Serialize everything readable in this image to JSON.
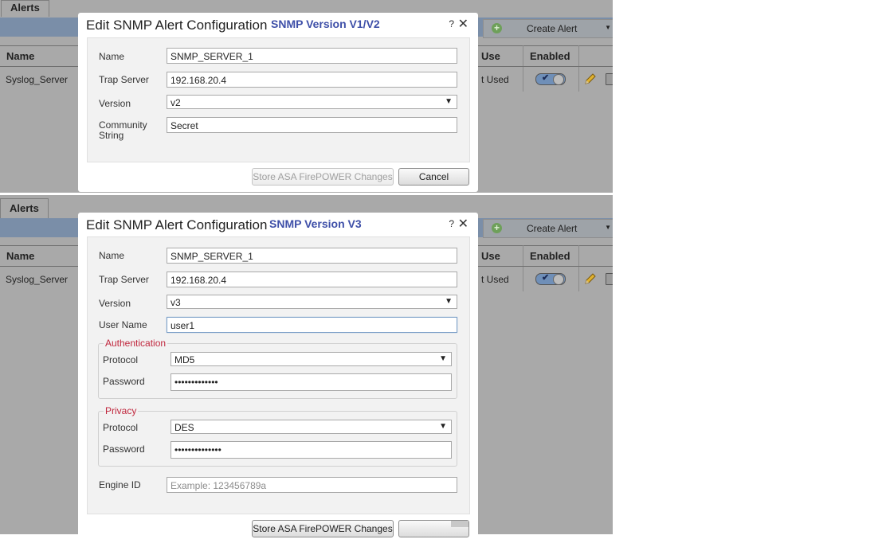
{
  "background": {
    "tab_label": "Alerts",
    "create_alert_label": "Create Alert",
    "columns": {
      "name": "Name",
      "use": "Use",
      "enabled": "Enabled"
    },
    "row": {
      "name": "Syslog_Server",
      "use": "t Used",
      "enabled": true
    }
  },
  "dialog_v1v2": {
    "title": "Edit SNMP Alert Configuration",
    "version_note": "SNMP Version V1/V2",
    "help": "?",
    "close": "✕",
    "fields": {
      "name_label": "Name",
      "name_value": "SNMP_SERVER_1",
      "trap_label": "Trap Server",
      "trap_value": "192.168.20.4",
      "version_label": "Version",
      "version_value": "v2",
      "community_label_1": "Community",
      "community_label_2": "String",
      "community_value": "Secret"
    },
    "store_button": "Store ASA FirePOWER Changes",
    "cancel_button": "Cancel"
  },
  "dialog_v3": {
    "title": "Edit SNMP Alert Configuration",
    "version_note": "SNMP Version V3",
    "help": "?",
    "close": "✕",
    "fields": {
      "name_label": "Name",
      "name_value": "SNMP_SERVER_1",
      "trap_label": "Trap Server",
      "trap_value": "192.168.20.4",
      "version_label": "Version",
      "version_value": "v3",
      "user_label": "User Name",
      "user_value": "user1"
    },
    "authentication": {
      "legend": "Authentication",
      "protocol_label": "Protocol",
      "protocol_value": "MD5",
      "password_label": "Password",
      "password_value": "•••••••••••••"
    },
    "privacy": {
      "legend": "Privacy",
      "protocol_label": "Protocol",
      "protocol_value": "DES",
      "password_label": "Password",
      "password_value": "••••••••••••••"
    },
    "engine": {
      "label": "Engine ID",
      "placeholder": "Example: 123456789a"
    },
    "store_button": "Store ASA FirePOWER Changes"
  }
}
